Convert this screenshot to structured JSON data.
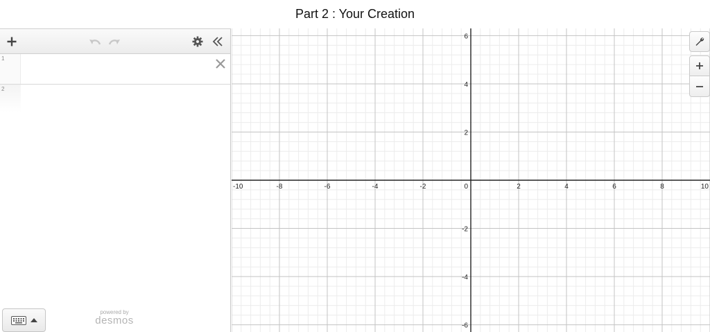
{
  "page": {
    "title": "Part 2 : Your Creation"
  },
  "expressions": {
    "rows": [
      {
        "index": "1",
        "value": ""
      },
      {
        "index": "2",
        "value": ""
      }
    ]
  },
  "branding": {
    "powered_by": "powered by",
    "name": "desmos"
  },
  "graph": {
    "x_range": [
      -10,
      10
    ],
    "y_range": [
      -6.3,
      6.3
    ],
    "major_step": 2,
    "minor_step": 0.4,
    "x_ticks": [
      "-10",
      "-8",
      "-6",
      "-4",
      "-2",
      "0",
      "2",
      "4",
      "6",
      "8",
      "10"
    ],
    "y_ticks": [
      "6",
      "4",
      "2",
      "-2",
      "-4",
      "-6"
    ]
  },
  "icons": {
    "add": "plus-icon",
    "undo": "undo-icon",
    "redo": "redo-icon",
    "settings": "gear-icon",
    "collapse": "double-chevron-left-icon",
    "delete": "close-icon",
    "keyboard": "keyboard-icon",
    "wrench": "wrench-icon",
    "zoom_in": "plus-icon",
    "zoom_out": "minus-icon"
  }
}
